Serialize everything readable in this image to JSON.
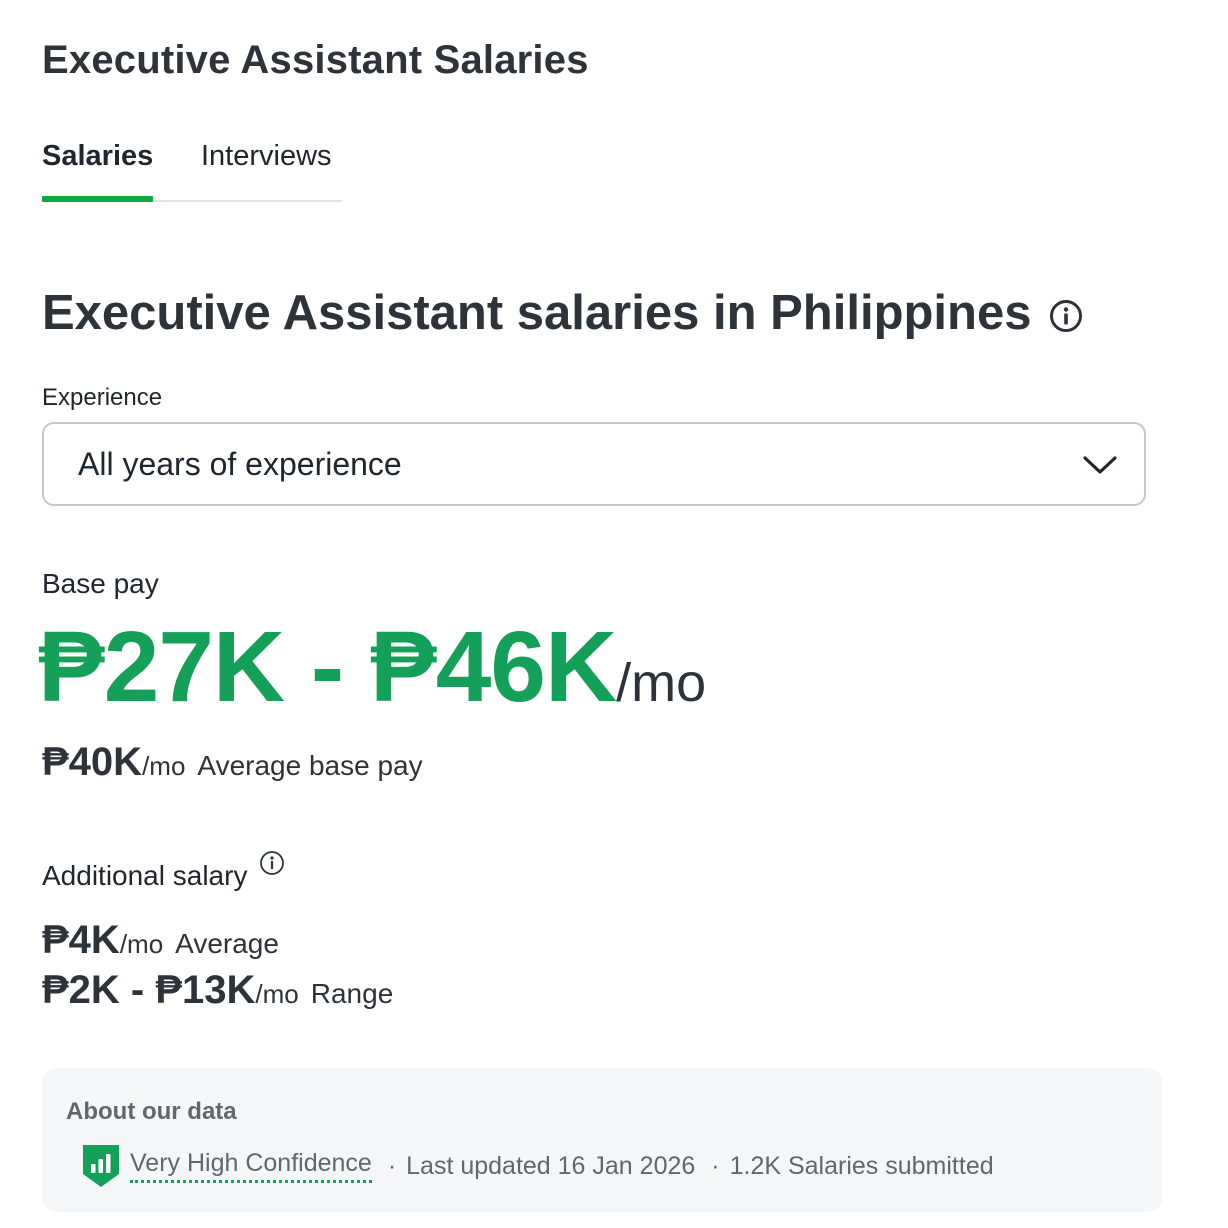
{
  "page": {
    "title": "Executive Assistant Salaries"
  },
  "tabs": [
    {
      "label": "Salaries",
      "active": true
    },
    {
      "label": "Interviews",
      "active": false
    }
  ],
  "section": {
    "heading": "Executive Assistant salaries in Philippines",
    "info_icon": "info-circle-icon"
  },
  "experience": {
    "label": "Experience",
    "selected": "All years of experience",
    "icon": "chevron-down-icon"
  },
  "base_pay": {
    "label": "Base pay",
    "range": "₱27K - ₱46K",
    "range_unit": "/mo",
    "average": "₱40K",
    "average_unit": "/mo",
    "average_desc": "Average base pay"
  },
  "additional_salary": {
    "label": "Additional salary",
    "info_icon": "info-circle-icon",
    "average": "₱4K",
    "average_unit": "/mo",
    "average_desc": "Average",
    "range": "₱2K - ₱13K",
    "range_unit": "/mo",
    "range_desc": "Range"
  },
  "about": {
    "title": "About our data",
    "confidence_icon": "shield-bar-chart-icon",
    "confidence": "Very High Confidence",
    "separator": "·",
    "last_updated": "Last updated 16 Jan 2026",
    "submitted": "1.2K Salaries submitted"
  },
  "colors": {
    "accent_green": "#0caa41",
    "range_green": "#14a058",
    "text_dark": "#2d3339",
    "text_muted": "#5f676f",
    "box_bg": "#f5f6f7"
  }
}
